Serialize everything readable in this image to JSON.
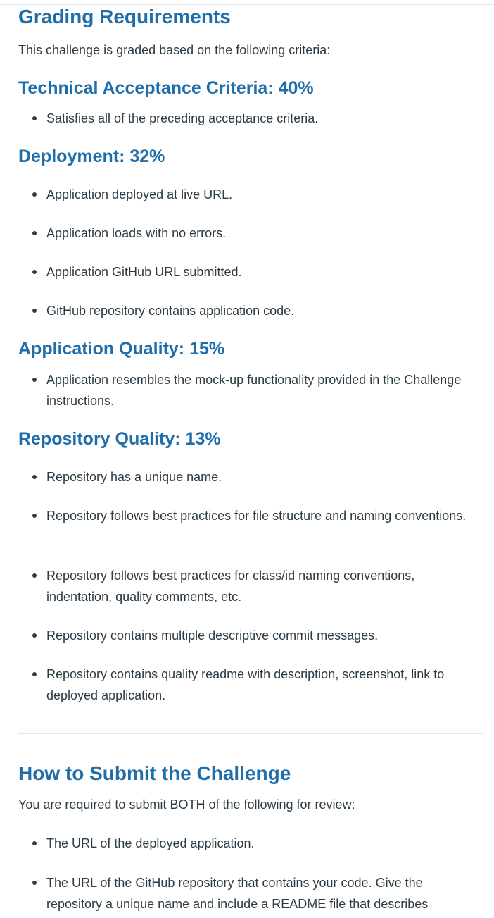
{
  "grading": {
    "title": "Grading Requirements",
    "intro": "This challenge is graded based on the following criteria:",
    "sections": [
      {
        "heading": "Technical Acceptance Criteria: 40%",
        "items": [
          "Satisfies all of the preceding acceptance criteria."
        ]
      },
      {
        "heading": "Deployment: 32%",
        "items": [
          "Application deployed at live URL.",
          "Application loads with no errors.",
          "Application GitHub URL submitted.",
          "GitHub repository contains application code."
        ]
      },
      {
        "heading": "Application Quality: 15%",
        "items": [
          "Application resembles the mock-up functionality provided in the Challenge instructions."
        ]
      },
      {
        "heading": "Repository Quality: 13%",
        "items": [
          "Repository has a unique name.",
          "Repository follows best practices for file structure and naming conventions.",
          "Repository follows best practices for class/id naming conventions, indentation, quality comments, etc.",
          "Repository contains multiple descriptive commit messages.",
          "Repository contains quality readme with description, screenshot, link to deployed application."
        ]
      }
    ]
  },
  "submit": {
    "title": "How to Submit the Challenge",
    "intro": "You are required to submit BOTH of the following for review:",
    "items": [
      "The URL of the deployed application.",
      "The URL of the GitHub repository that contains your code. Give the repository a unique name and include a README file that describes"
    ]
  }
}
